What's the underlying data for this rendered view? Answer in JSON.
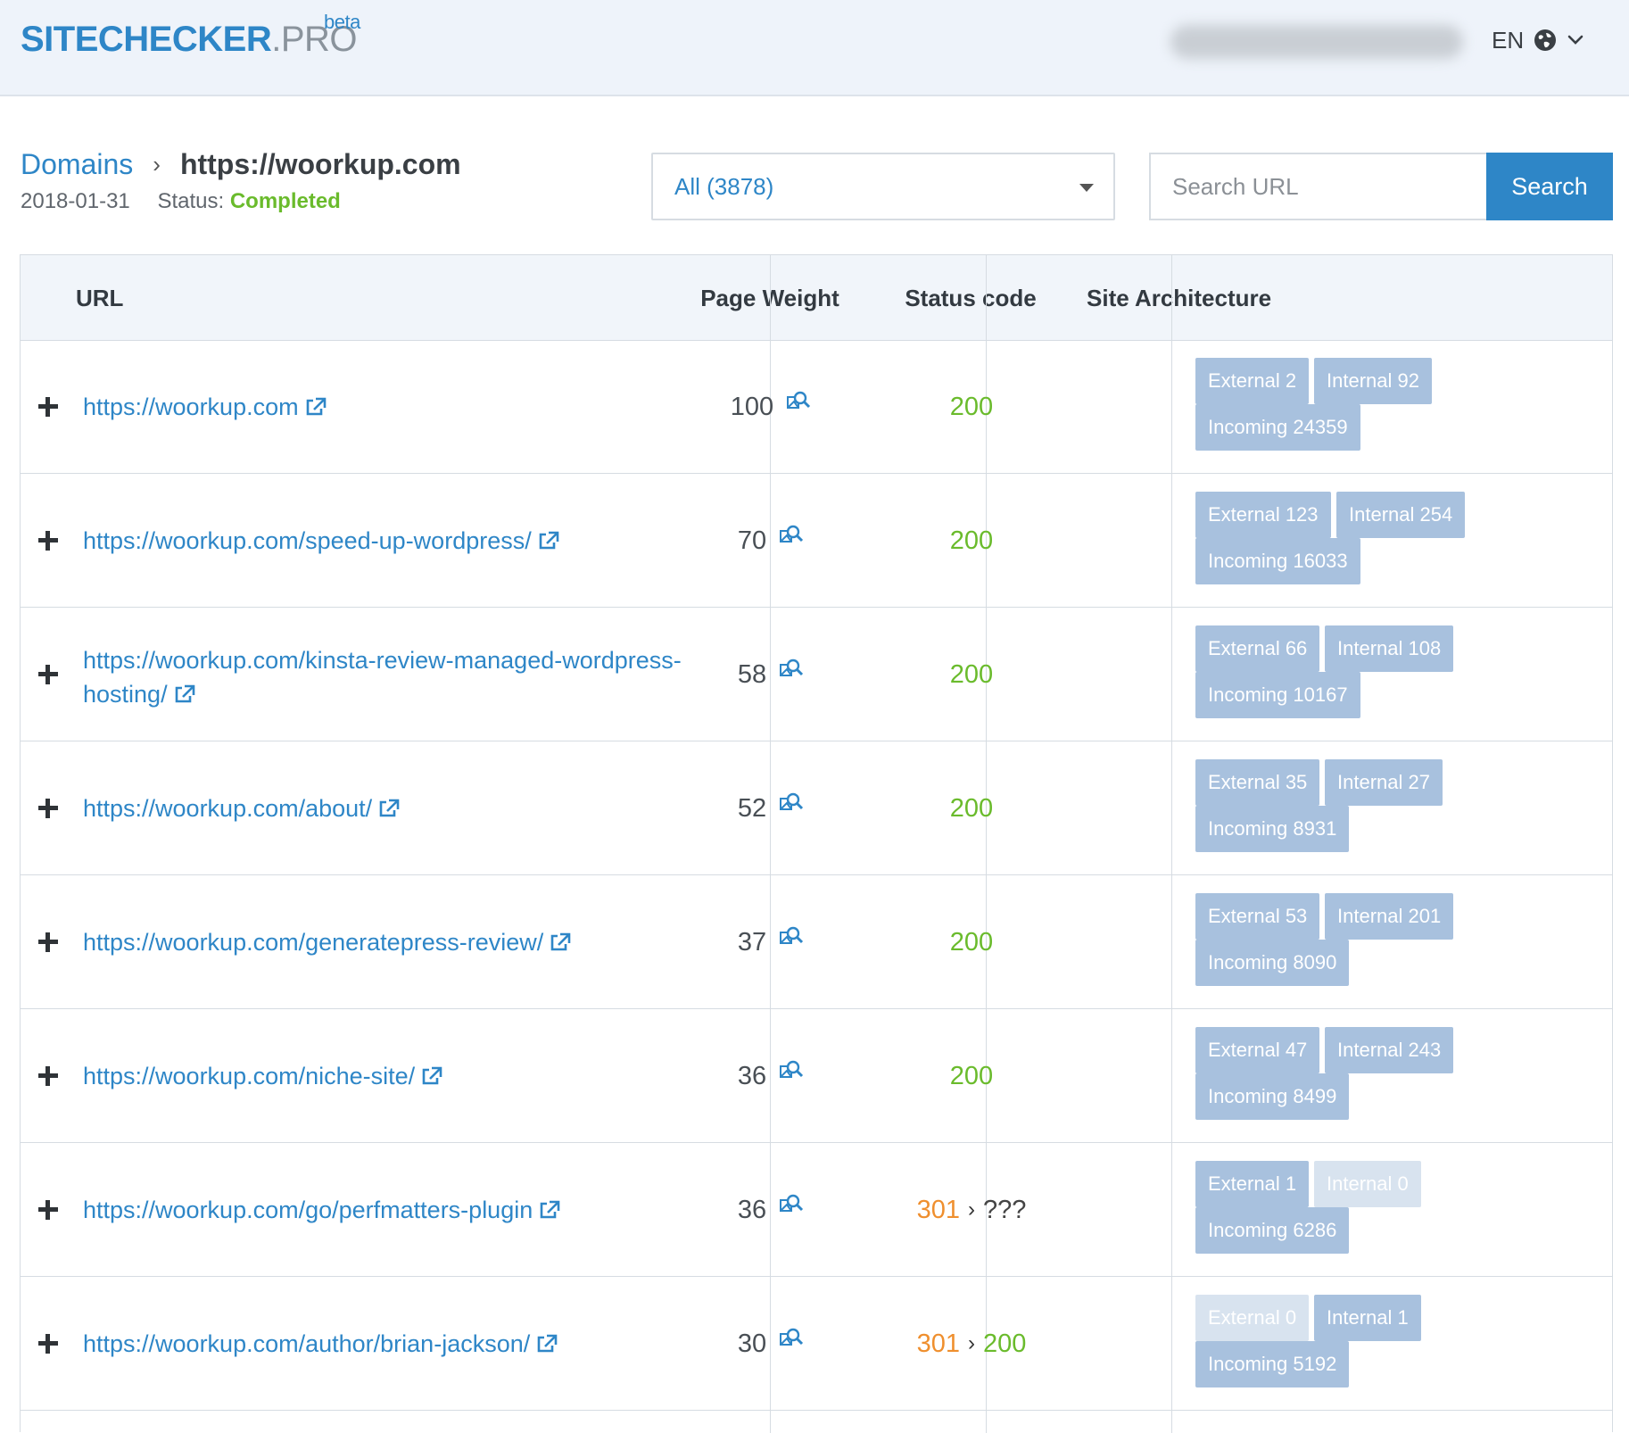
{
  "header": {
    "logo_main": "SITECHECKER",
    "logo_suffix": ".PRO",
    "logo_badge": "beta",
    "language": "EN"
  },
  "breadcrumb": {
    "root": "Domains",
    "separator": "›",
    "current": "https://woorkup.com"
  },
  "scan": {
    "date": "2018-01-31",
    "status_label": "Status:",
    "status_value": "Completed"
  },
  "filter": {
    "selected": "All (3878)"
  },
  "search": {
    "placeholder": "Search URL",
    "button": "Search"
  },
  "table": {
    "columns": [
      "URL",
      "Page Weight",
      "Status code",
      "Site Architecture"
    ],
    "rows": [
      {
        "url": "https://woorkup.com",
        "weight": "100",
        "status": "200",
        "external": "External 2",
        "internal": "Internal 92",
        "incoming": "Incoming 24359"
      },
      {
        "url": "https://woorkup.com/speed-up-wordpress/",
        "weight": "70",
        "status": "200",
        "external": "External 123",
        "internal": "Internal 254",
        "incoming": "Incoming 16033"
      },
      {
        "url_line1": "https://woorkup.com/kinsta-review-managed-wordpress-",
        "url_line2": "hosting/",
        "weight": "58",
        "status": "200",
        "external": "External 66",
        "internal": "Internal 108",
        "incoming": "Incoming 10167"
      },
      {
        "url": "https://woorkup.com/about/",
        "weight": "52",
        "status": "200",
        "external": "External 35",
        "internal": "Internal 27",
        "incoming": "Incoming 8931"
      },
      {
        "url": "https://woorkup.com/generatepress-review/",
        "weight": "37",
        "status": "200",
        "external": "External 53",
        "internal": "Internal 201",
        "incoming": "Incoming 8090"
      },
      {
        "url": "https://woorkup.com/niche-site/",
        "weight": "36",
        "status": "200",
        "external": "External 47",
        "internal": "Internal 243",
        "incoming": "Incoming 8499"
      },
      {
        "url": "https://woorkup.com/go/perfmatters-plugin",
        "weight": "36",
        "status": "301",
        "redirect_target": "???",
        "external": "External 1",
        "internal": "Internal 0",
        "incoming": "Incoming 6286"
      },
      {
        "url": "https://woorkup.com/author/brian-jackson/",
        "weight": "30",
        "status": "301",
        "redirect_target": "200",
        "external": "External 0",
        "internal": "Internal 1",
        "incoming": "Incoming 5192"
      }
    ]
  },
  "colors": {
    "accent": "#2e86c7",
    "status_ok": "#6abb2c",
    "status_redirect": "#ef8f2e",
    "tag": "#a8c1de",
    "tag_disabled": "#d8e3ef"
  },
  "icons": [
    "globe-icon",
    "chevron-down-icon",
    "caret-down-icon",
    "plus-icon",
    "external-link-icon",
    "page-weight-inspect-icon"
  ]
}
